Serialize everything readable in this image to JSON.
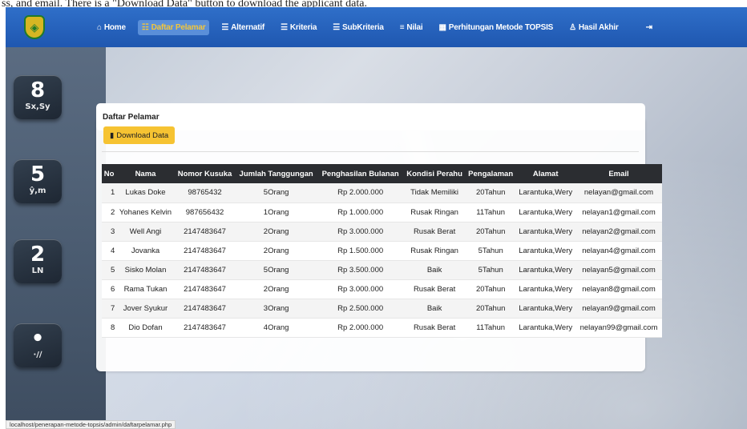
{
  "caption": "ss, and email. There is a \"Download Data\" button to download the applicant data.",
  "nav": {
    "items": [
      {
        "label": "Home",
        "icon": "home-icon",
        "glyph": "⌂",
        "active": false
      },
      {
        "label": "Daftar Pelamar",
        "icon": "users-icon",
        "glyph": "☷",
        "active": true
      },
      {
        "label": "Alternatif",
        "icon": "list-icon",
        "glyph": "☰",
        "active": false
      },
      {
        "label": "Kriteria",
        "icon": "list-icon",
        "glyph": "☰",
        "active": false
      },
      {
        "label": "SubKriteria",
        "icon": "list-icon",
        "glyph": "☰",
        "active": false
      },
      {
        "label": "Nilai",
        "icon": "chart-icon",
        "glyph": "≡",
        "active": false
      },
      {
        "label": "Perhitungan Metode TOPSIS",
        "icon": "calculator-icon",
        "glyph": "▦",
        "active": false
      },
      {
        "label": "Hasil Akhir",
        "icon": "user-icon",
        "glyph": "♙",
        "active": false
      }
    ],
    "logout_glyph": "⇥"
  },
  "page": {
    "title": "Daftar Pelamar",
    "download_label": "Download Data"
  },
  "table": {
    "headers": [
      "No",
      "Nama",
      "Nomor Kusuka",
      "Jumlah Tanggungan",
      "Penghasilan Bulanan",
      "Kondisi Perahu",
      "Pengalaman",
      "Alamat",
      "Email"
    ],
    "rows": [
      [
        "1",
        "Lukas Doke",
        "98765432",
        "5Orang",
        "Rp 2.000.000",
        "Tidak Memiliki",
        "20Tahun",
        "Larantuka,Wery",
        "nelayan@gmail.com"
      ],
      [
        "2",
        "Yohanes Kelvin",
        "987656432",
        "1Orang",
        "Rp 1.000.000",
        "Rusak Ringan",
        "11Tahun",
        "Larantuka,Wery",
        "nelayan1@gmail.com"
      ],
      [
        "3",
        "Well Angi",
        "2147483647",
        "2Orang",
        "Rp 3.000.000",
        "Rusak Berat",
        "20Tahun",
        "Larantuka,Wery",
        "nelayan2@gmail.com"
      ],
      [
        "4",
        "Jovanka",
        "2147483647",
        "2Orang",
        "Rp 1.500.000",
        "Rusak Ringan",
        "5Tahun",
        "Larantuka,Wery",
        "nelayan4@gmail.com"
      ],
      [
        "5",
        "Sisko Molan",
        "2147483647",
        "5Orang",
        "Rp 3.500.000",
        "Baik",
        "5Tahun",
        "Larantuka,Wery",
        "nelayan5@gmail.com"
      ],
      [
        "6",
        "Rama Tukan",
        "2147483647",
        "2Orang",
        "Rp 3.000.000",
        "Rusak Berat",
        "20Tahun",
        "Larantuka,Wery",
        "nelayan8@gmail.com"
      ],
      [
        "7",
        "Jover Syukur",
        "2147483647",
        "3Orang",
        "Rp 2.500.000",
        "Baik",
        "20Tahun",
        "Larantuka,Wery",
        "nelayan9@gmail.com"
      ],
      [
        "8",
        "Dio Dofan",
        "2147483647",
        "4Orang",
        "Rp 2.000.000",
        "Rusak Berat",
        "11Tahun",
        "Larantuka,Wery",
        "nelayan99@gmail.com"
      ]
    ]
  },
  "status_url": "localhost/penerapan-metode-topsis/admin/daftarpelamar.php",
  "calculator_keys": [
    {
      "big": "8",
      "small": "Sx,Sy"
    },
    {
      "big": "5",
      "small": "ŷ,m"
    },
    {
      "big": "2",
      "small": "LN"
    },
    {
      "big": "•",
      "small": "·/∕"
    }
  ],
  "colors": {
    "nav": "#1f57b0",
    "active_text": "#f3c63a",
    "button": "#f6c332",
    "table_header": "#2b2d31"
  }
}
